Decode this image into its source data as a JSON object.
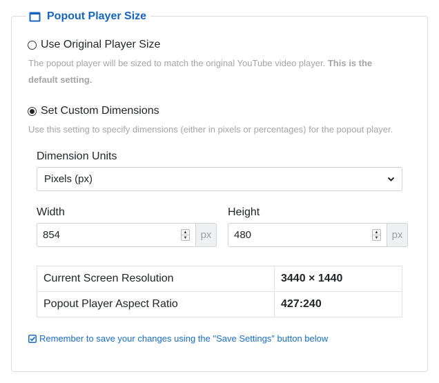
{
  "legend": {
    "title": "Popout Player Size",
    "icon": "window-icon"
  },
  "options": [
    {
      "label": "Use Original Player Size",
      "selected": false,
      "help": "The popout player will be sized to match the original YouTube video player.",
      "help_bold": "This is the",
      "help_bold_2": "default setting."
    },
    {
      "label": "Set Custom Dimensions",
      "selected": true,
      "help": "Use this setting to specify dimensions (either in pixels or percentages) for the popout player."
    }
  ],
  "units": {
    "label": "Dimension Units",
    "selected": "Pixels (px)"
  },
  "width": {
    "label": "Width",
    "value": "854",
    "unit": "px"
  },
  "height": {
    "label": "Height",
    "value": "480",
    "unit": "px"
  },
  "info_table": [
    {
      "label": "Current Screen Resolution",
      "value": "3440 × 1440"
    },
    {
      "label": "Popout Player Aspect Ratio",
      "value": "427:240"
    }
  ],
  "note": "Remember to save your changes using the \"Save Settings\" button below",
  "colors": {
    "accent": "#1565c0",
    "link": "#1a6dc7",
    "muted": "#a5a5a5"
  }
}
